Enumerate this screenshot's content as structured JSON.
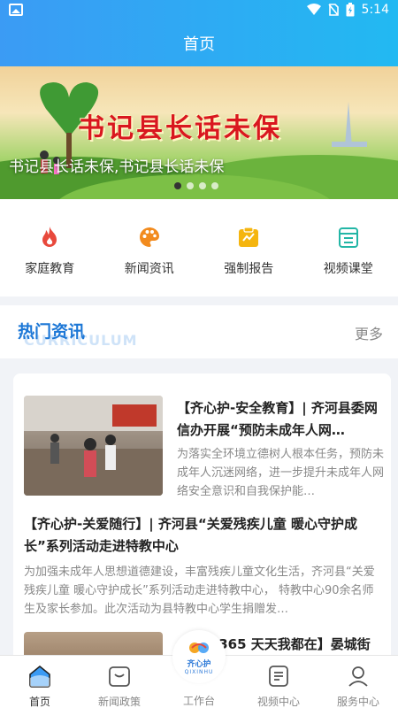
{
  "status_bar": {
    "time": "5:14"
  },
  "header": {
    "title": "首页"
  },
  "banner": {
    "title": "书记县长话未保",
    "caption": "书记县长话未保,书记县长话未保",
    "slides_total": 4,
    "active_slide": 1
  },
  "quick_nav": [
    {
      "label": "家庭教育",
      "icon": "flame-icon",
      "color": "#e8493c"
    },
    {
      "label": "新闻资讯",
      "icon": "palette-icon",
      "color": "#f28b1e"
    },
    {
      "label": "强制报告",
      "icon": "report-icon",
      "color": "#f5b50f"
    },
    {
      "label": "视频课堂",
      "icon": "list-icon",
      "color": "#23b6a6"
    }
  ],
  "section": {
    "title": "热门资讯",
    "subtitle": "CURRICULUM",
    "more_label": "更多"
  },
  "news": [
    {
      "title": "【齐心护-安全教育】| 齐河县委网信办开展“预防未成年人网…",
      "desc": "为落实全环境立德树人根本任务，预防未成年人沉迷网络，进一步提升未成年人网络安全意识和自我保护能…"
    },
    {
      "title": "【齐心护-关爱随行】| 齐河县“关爱残疾儿童 暖心守护成长”系列活动走进特教中心",
      "desc": "为加强未成年人思想道德建设，丰富残疾儿童文化生活，齐河县“关爱残疾儿童 暖心守护成长”系列活动走进特教中心， 特教中心90余名师生及家长参加。此次活动为县特教中心学生捐赠发…"
    },
    {
      "title": "【 365 天天我都在】晏城街"
    }
  ],
  "center_badge": {
    "name": "齐心护",
    "sub": "QIXINHU"
  },
  "tabs": [
    {
      "label": "首页",
      "icon": "home-icon",
      "active": true
    },
    {
      "label": "新闻政策",
      "icon": "news-policy-icon",
      "active": false
    },
    {
      "label": "工作台",
      "icon": "workbench-icon",
      "active": false
    },
    {
      "label": "视频中心",
      "icon": "video-center-icon",
      "active": false
    },
    {
      "label": "服务中心",
      "icon": "person-icon",
      "active": false
    }
  ],
  "colors": {
    "header_start": "#3b9bf4",
    "header_end": "#22b9f2",
    "section_title": "#1c77d6",
    "brand_red": "#d9171f"
  }
}
